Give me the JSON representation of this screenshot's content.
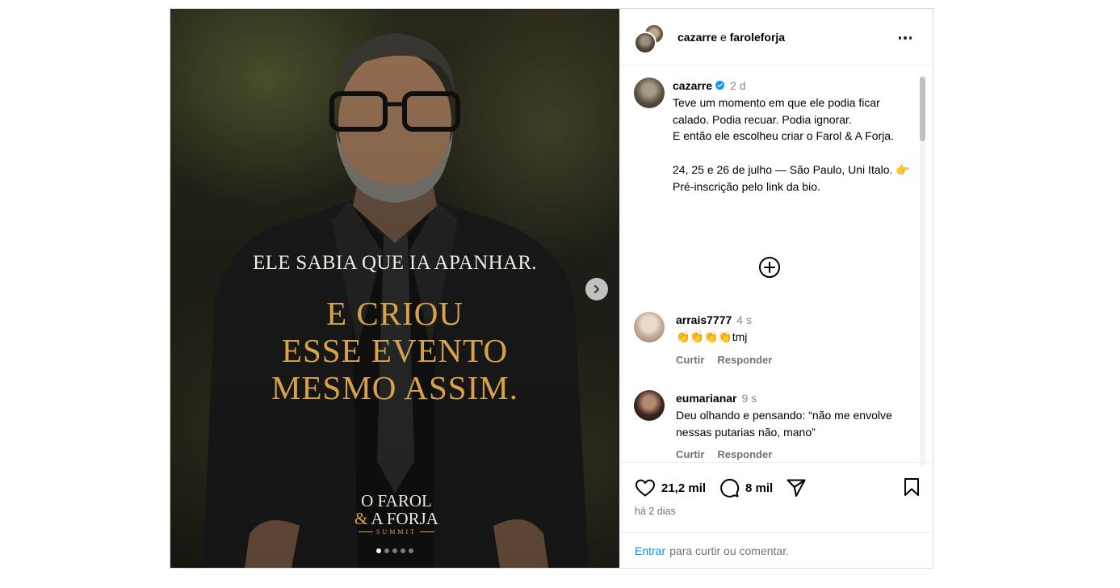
{
  "colors": {
    "accent_gold": "#d9a24a",
    "link_blue": "#0095f6",
    "verified_blue": "#0095f6",
    "muted_text": "#737373"
  },
  "media": {
    "headline_small": "ELE SABIA QUE IA APANHAR.",
    "headline_large": [
      "E CRIOU",
      "ESSE EVENTO",
      "MESMO ASSIM."
    ],
    "logo": {
      "line1": "O FAROL",
      "amp": "&",
      "line2": "A FORJA",
      "summit": "SUMMIT"
    },
    "carousel": {
      "slide_count": 5,
      "active_index": 0
    },
    "next_icon": "chevron-right-icon"
  },
  "header": {
    "user1": "cazarre",
    "conjunction": "e",
    "user2": "faroleforja",
    "more_icon": "more-horizontal-icon"
  },
  "caption": {
    "username": "cazarre",
    "verified": true,
    "time": "2 d",
    "text": "Teve um momento em que ele podia ficar calado. Podia recuar. Podia ignorar.\nE então ele escolheu criar o Farol & A Forja.\n\n24, 25 e 26 de julho — São Paulo, Uni Italo. 👉 Pré-inscrição pelo link da bio."
  },
  "load_more_icon": "plus-circle-icon",
  "comments": [
    {
      "username": "arrais7777",
      "time": "4 s",
      "text": "👏👏👏👏tmj",
      "like_label": "Curtir",
      "reply_label": "Responder"
    },
    {
      "username": "eumarianar",
      "time": "9 s",
      "text": "Deu olhando e pensando: “não me envolve nessas putarias não, mano”",
      "like_label": "Curtir",
      "reply_label": "Responder"
    }
  ],
  "actions": {
    "likes": "21,2 mil",
    "comments": "8 mil",
    "date": "há 2 dias",
    "icons": [
      "heart-icon",
      "comment-icon",
      "share-icon",
      "bookmark-icon"
    ]
  },
  "login_bar": {
    "link": "Entrar",
    "text": "para curtir ou comentar."
  }
}
